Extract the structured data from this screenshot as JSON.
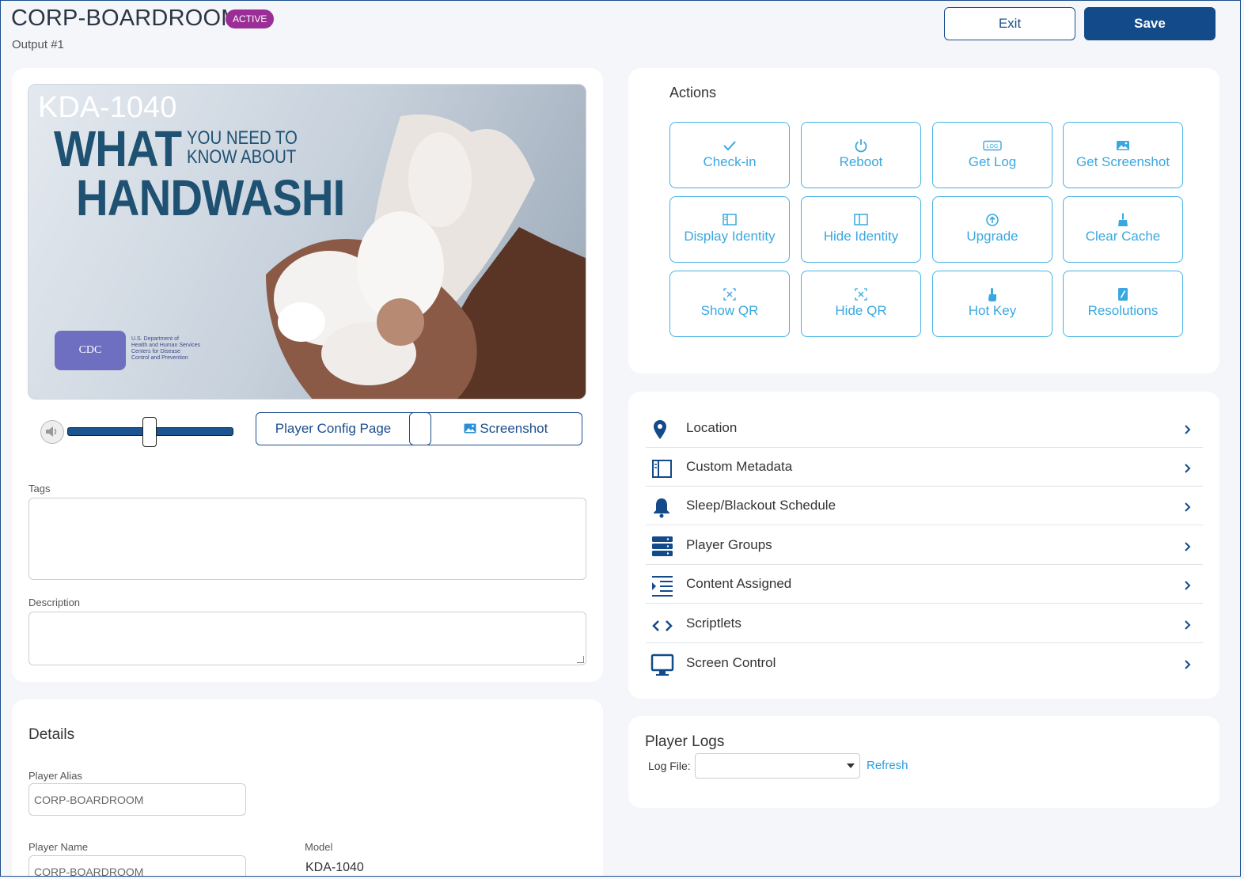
{
  "header": {
    "title": "CORP-BOARDROOM",
    "status_badge": "ACTIVE",
    "subtitle": "Output #1",
    "exit_label": "Exit",
    "save_label": "Save"
  },
  "preview": {
    "model_text": "KDA-1040",
    "headline_what": "WHAT",
    "headline_need": "YOU NEED TO",
    "headline_know": "KNOW ABOUT",
    "headline_hand": "HANDWASHI",
    "logo_text": "CDC",
    "agency_line1": "U.S. Department of",
    "agency_line2": "Health and Human Services",
    "agency_line3": "Centers for Disease",
    "agency_line4": "Control and Prevention"
  },
  "player_controls": {
    "volume_level": 0.5,
    "config_label": "Player Config Page",
    "screenshot_label": "Screenshot"
  },
  "form": {
    "tags_label": "Tags",
    "tags_value": "",
    "description_label": "Description",
    "description_value": ""
  },
  "details": {
    "title": "Details",
    "alias_label": "Player Alias",
    "alias_value": "CORP-BOARDROOM",
    "name_label": "Player Name",
    "name_value": "CORP-BOARDROOM",
    "model_label": "Model",
    "model_value": "KDA-1040"
  },
  "actions": {
    "title": "Actions",
    "buttons": [
      {
        "label": "Check-in",
        "icon": "check-icon"
      },
      {
        "label": "Reboot",
        "icon": "power-icon"
      },
      {
        "label": "Get Log",
        "icon": "log-icon"
      },
      {
        "label": "Get Screenshot",
        "icon": "image-icon"
      },
      {
        "label": "Display Identity",
        "icon": "identity-card-icon"
      },
      {
        "label": "Hide Identity",
        "icon": "identity-hide-icon"
      },
      {
        "label": "Upgrade",
        "icon": "upgrade-arrow-icon"
      },
      {
        "label": "Clear Cache",
        "icon": "broom-icon"
      },
      {
        "label": "Show QR",
        "icon": "qr-scan-icon"
      },
      {
        "label": "Hide QR",
        "icon": "qr-hide-icon"
      },
      {
        "label": "Hot Key",
        "icon": "hand-pointer-icon"
      },
      {
        "label": "Resolutions",
        "icon": "resolution-icon"
      }
    ]
  },
  "nav": {
    "items": [
      {
        "label": "Location",
        "icon": "map-pin-icon"
      },
      {
        "label": "Custom Metadata",
        "icon": "metadata-panel-icon"
      },
      {
        "label": "Sleep/Blackout Schedule",
        "icon": "bell-icon"
      },
      {
        "label": "Player Groups",
        "icon": "server-stack-icon"
      },
      {
        "label": "Content Assigned",
        "icon": "list-indent-icon"
      },
      {
        "label": "Scriptlets",
        "icon": "code-brackets-icon"
      },
      {
        "label": "Screen Control",
        "icon": "monitor-icon"
      }
    ]
  },
  "logs": {
    "title": "Player Logs",
    "log_file_label": "Log File:",
    "log_file_value": "",
    "refresh_label": "Refresh"
  },
  "colors": {
    "primary": "#124a8a",
    "accent": "#3aa8e0",
    "badge": "#9b2d96"
  }
}
